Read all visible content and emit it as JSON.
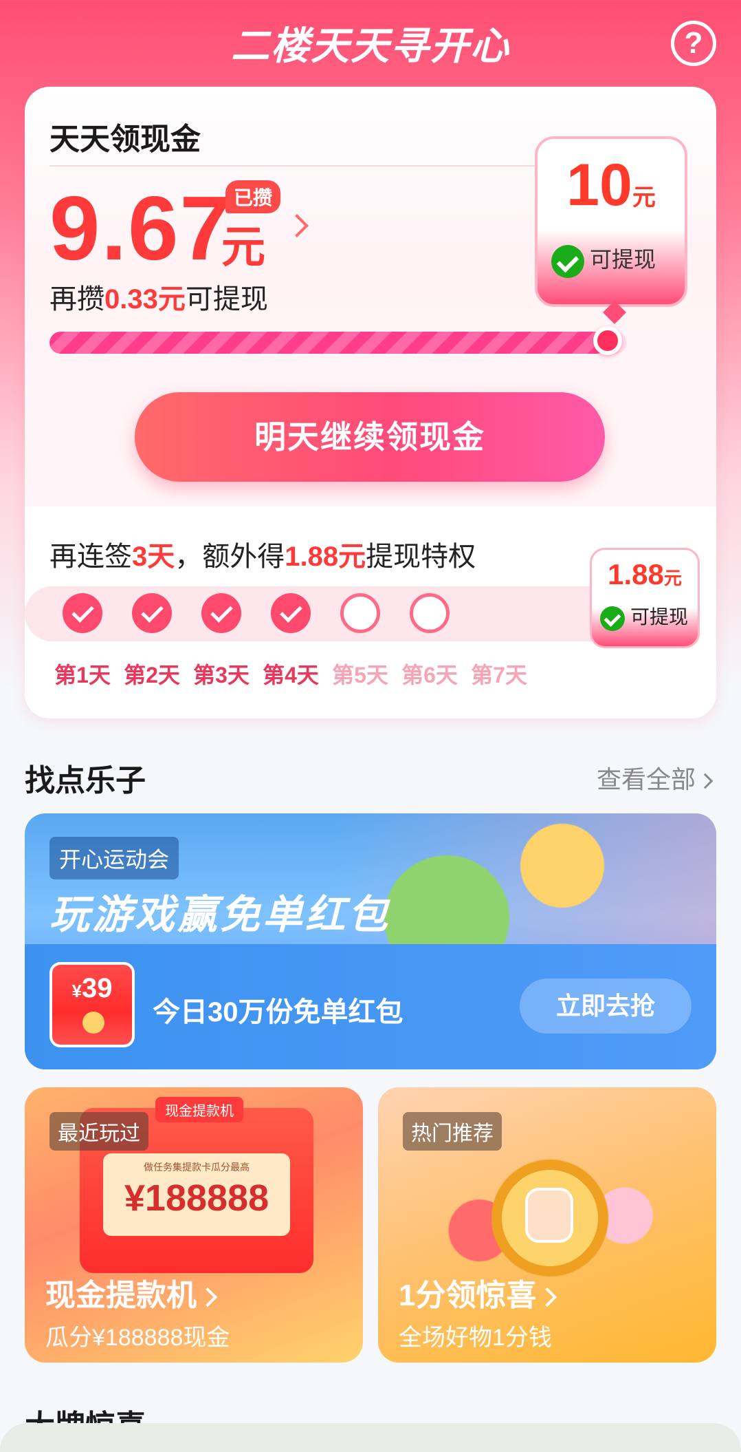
{
  "header": {
    "title": "二楼天天寻开心"
  },
  "cash": {
    "title": "天天领现金",
    "amount": "9.67",
    "unit": "元",
    "saved_badge": "已攒",
    "need_prefix": "再攒",
    "need_amount": "0.33元",
    "need_suffix": "可提现",
    "goal_value": "10",
    "goal_unit": "元",
    "goal_label": "可提现",
    "progress": 0.967,
    "cta": "明天继续领现金"
  },
  "streak": {
    "prefix": "再连签",
    "days": "3天",
    "middle": "，额外得",
    "bonus": "1.88元",
    "suffix": "提现特权",
    "bonus_value": "1.88",
    "bonus_unit": "元",
    "bonus_label": "可提现",
    "day_items": [
      {
        "label": "第1天",
        "done": true
      },
      {
        "label": "第2天",
        "done": true
      },
      {
        "label": "第3天",
        "done": true
      },
      {
        "label": "第4天",
        "done": true
      },
      {
        "label": "第5天",
        "done": false
      },
      {
        "label": "第6天",
        "done": false
      },
      {
        "label": "第7天",
        "done": false
      }
    ]
  },
  "fun": {
    "title": "找点乐子",
    "view_all": "查看全部"
  },
  "banner": {
    "tag": "开心运动会",
    "title": "玩游戏赢免单红包",
    "redpack_yen": "¥",
    "redpack_amount": "39",
    "desc": "今日30万份免单红包",
    "button": "立即去抢"
  },
  "tiles": {
    "left": {
      "tag": "最近玩过",
      "machine_label": "现金提款机",
      "screen_note": "做任务集提款卡瓜分最高",
      "screen_amount": "¥188888",
      "title": "现金提款机",
      "sub": "瓜分¥188888现金"
    },
    "right": {
      "tag": "热门推荐",
      "title": "1分领惊喜",
      "sub": "全场好物1分钱"
    }
  },
  "next_section": {
    "title": "大牌惊喜"
  }
}
